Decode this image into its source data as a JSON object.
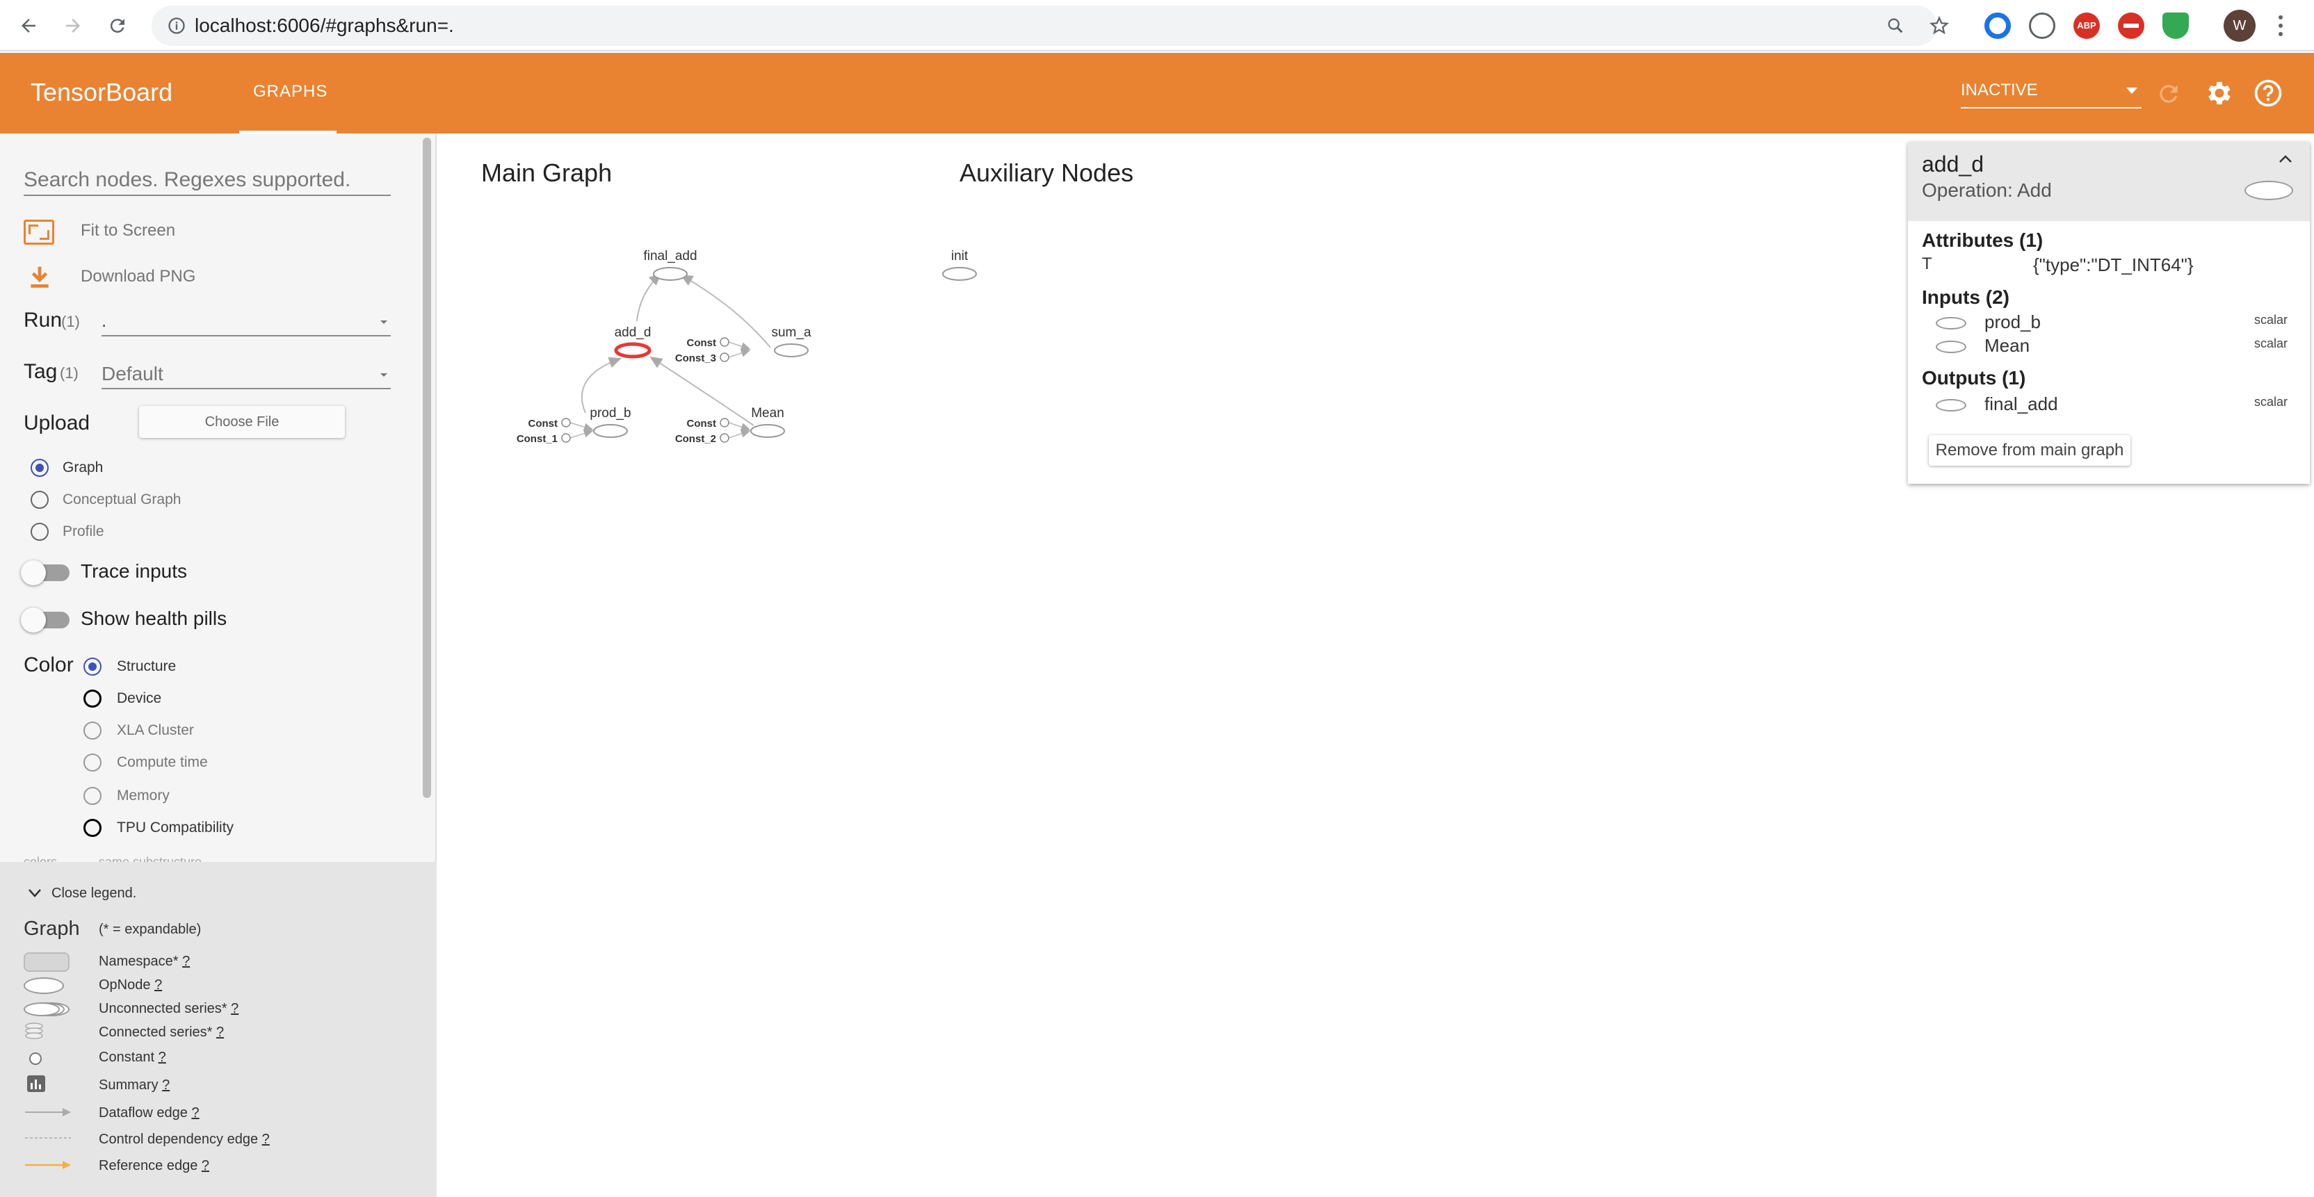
{
  "browser": {
    "url": "localhost:6006/#graphs&run=.",
    "profile_initial": "W",
    "extension_abp_label": "ABP"
  },
  "toolbar": {
    "title": "TensorBoard",
    "tab_graphs": "GRAPHS",
    "status_select": "INACTIVE",
    "accent_color": "#e98331"
  },
  "sidebar": {
    "search_placeholder": "Search nodes. Regexes supported.",
    "fit_to_screen": "Fit to Screen",
    "download_png": "Download PNG",
    "run_label": "Run",
    "run_count": "(1)",
    "run_value": ".",
    "tag_label": "Tag",
    "tag_count": "(1)",
    "tag_value": "Default",
    "upload_label": "Upload",
    "choose_file": "Choose File",
    "graph_types": [
      "Graph",
      "Conceptual Graph",
      "Profile"
    ],
    "trace_inputs": "Trace inputs",
    "show_health_pills": "Show health pills",
    "color_label": "Color",
    "color_options": [
      "Structure",
      "Device",
      "XLA Cluster",
      "Compute time",
      "Memory",
      "TPU Compatibility"
    ],
    "cut_off_colors": "colors",
    "cut_off_same": "same substructure"
  },
  "legend": {
    "close": "Close legend.",
    "graph_label": "Graph",
    "expandable_note": "(* = expandable)",
    "items": [
      "Namespace*",
      "OpNode",
      "Unconnected series*",
      "Connected series*",
      "Constant",
      "Summary",
      "Dataflow edge",
      "Control dependency edge",
      "Reference edge"
    ],
    "help_mark": "?"
  },
  "main": {
    "main_graph_title": "Main Graph",
    "aux_title": "Auxiliary Nodes",
    "nodes": {
      "final_add": "final_add",
      "add_d": "add_d",
      "sum_a": "sum_a",
      "prod_b": "prod_b",
      "mean": "Mean",
      "const_a": "Const",
      "const_3": "Const_3",
      "const_b": "Const",
      "const_1": "Const_1",
      "const_c": "Const",
      "const_2": "Const_2",
      "init": "init"
    },
    "edge_label": "scalar"
  },
  "info_card": {
    "node_name": "add_d",
    "operation": "Operation: Add",
    "attributes_header": "Attributes (1)",
    "attr_key": "T",
    "attr_value": "{\"type\":\"DT_INT64\"}",
    "inputs_header": "Inputs (2)",
    "inputs": [
      "prod_b",
      "Mean"
    ],
    "outputs_header": "Outputs (1)",
    "outputs": [
      "final_add"
    ],
    "io_type": "scalar",
    "remove_button": "Remove from main graph"
  }
}
